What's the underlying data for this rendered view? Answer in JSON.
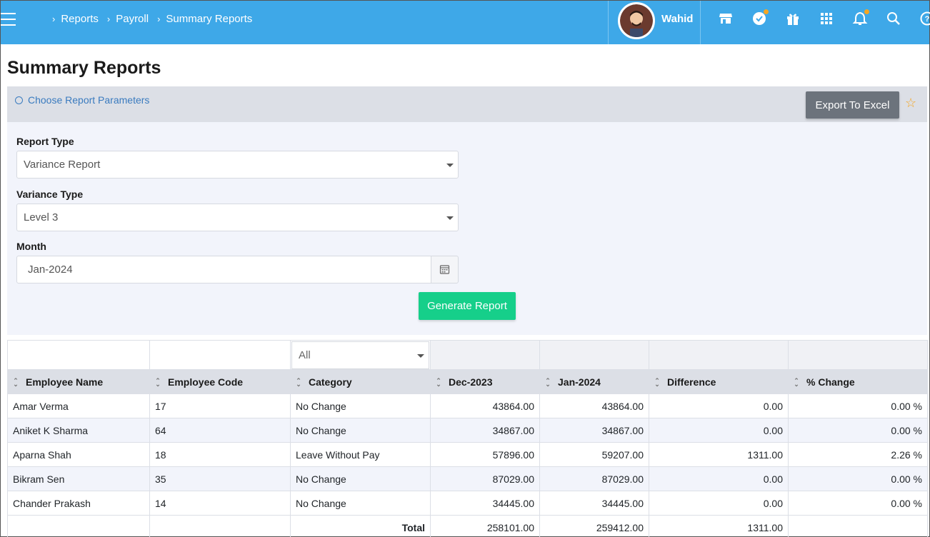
{
  "header": {
    "breadcrumb": [
      "Reports",
      "Payroll",
      "Summary Reports"
    ],
    "user_name": "Wahid",
    "icons": [
      "store-icon",
      "verified-badge-icon",
      "gift-icon",
      "apps-grid-icon",
      "bell-icon",
      "search-icon",
      "help-icon"
    ]
  },
  "page": {
    "title": "Summary Reports"
  },
  "panel": {
    "header_label": "Choose Report Parameters",
    "export_label": "Export To Excel",
    "report_type_label": "Report Type",
    "report_type_value": "Variance Report",
    "variance_type_label": "Variance Type",
    "variance_type_value": "Level 3",
    "month_label": "Month",
    "month_value": "Jan-2024",
    "generate_label": "Generate Report"
  },
  "table": {
    "category_filter": "All",
    "columns": [
      "Employee Name",
      "Employee Code",
      "Category",
      "Dec-2023",
      "Jan-2024",
      "Difference",
      "% Change"
    ],
    "rows": [
      [
        "Amar Verma",
        "17",
        "No Change",
        "43864.00",
        "43864.00",
        "0.00",
        "0.00 %"
      ],
      [
        "Aniket K Sharma",
        "64",
        "No Change",
        "34867.00",
        "34867.00",
        "0.00",
        "0.00 %"
      ],
      [
        "Aparna Shah",
        "18",
        "Leave Without Pay",
        "57896.00",
        "59207.00",
        "1311.00",
        "2.26 %"
      ],
      [
        "Bikram Sen",
        "35",
        "No Change",
        "87029.00",
        "87029.00",
        "0.00",
        "0.00 %"
      ],
      [
        "Chander Prakash",
        "14",
        "No Change",
        "34445.00",
        "34445.00",
        "0.00",
        "0.00 %"
      ]
    ],
    "total": {
      "label": "Total",
      "dec": "258101.00",
      "jan": "259412.00",
      "difference": "1311.00"
    }
  },
  "colors": {
    "topbar": "#3ea8e8",
    "generate_button": "#16cf8a",
    "export_button": "#6c737c",
    "link": "#3a7bbf",
    "star": "#f5a623"
  }
}
